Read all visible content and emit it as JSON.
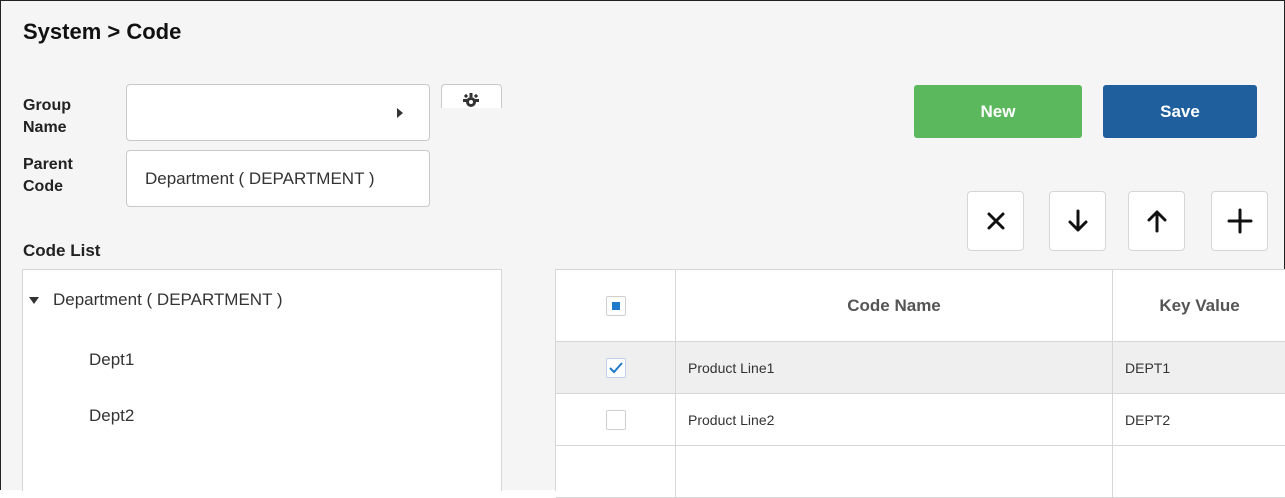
{
  "header": {
    "title": "System > Code"
  },
  "form": {
    "group_name_label_1": "Group",
    "group_name_label_2": "Name",
    "group_name_value": "",
    "parent_code_label_1": "Parent",
    "parent_code_label_2": "Code",
    "parent_code_value": "Department ( DEPARTMENT )"
  },
  "actions": {
    "new_label": "New",
    "save_label": "Save"
  },
  "toolbar": {
    "icons": [
      "close-icon",
      "arrow-down-icon",
      "arrow-up-icon",
      "plus-icon"
    ]
  },
  "tree": {
    "title": "Code List",
    "root": "Department ( DEPARTMENT )",
    "children": [
      "Dept1",
      "Dept2"
    ]
  },
  "grid": {
    "columns": [
      "Code Name",
      "Key Value"
    ],
    "rows": [
      {
        "checked": true,
        "code_name": "Product Line1",
        "key_value": "DEPT1"
      },
      {
        "checked": false,
        "code_name": "Product Line2",
        "key_value": "DEPT2"
      }
    ]
  },
  "colors": {
    "new_button": "#5cb85c",
    "save_button": "#1f5f9d",
    "check_accent": "#1f7acc"
  }
}
